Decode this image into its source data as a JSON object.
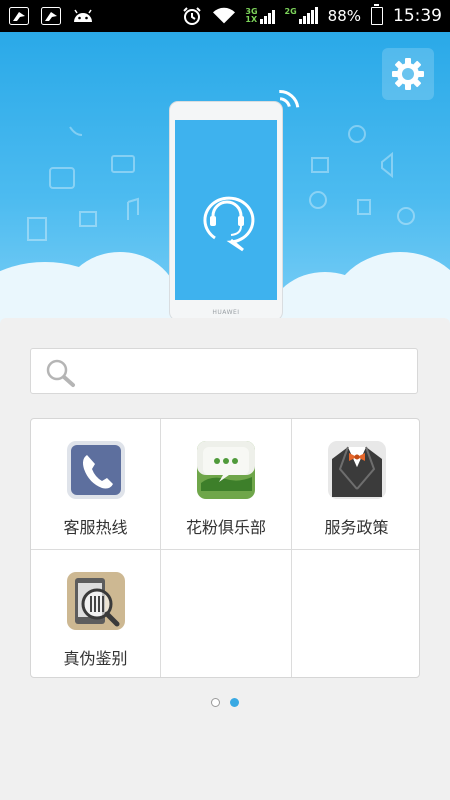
{
  "status_bar": {
    "battery": "88%",
    "time": "15:39",
    "network_tags": [
      "3G",
      "1X",
      "2G"
    ],
    "notification_icons": [
      "bird-app-icon",
      "bird-app-icon",
      "android-icon"
    ],
    "status_icons": [
      "alarm-icon",
      "wifi-icon",
      "signal-icon",
      "battery-charging-icon"
    ]
  },
  "hero": {
    "phone_brand": "HUAWEI",
    "screen_icon": "headset-chat-icon",
    "settings_icon": "gear-icon",
    "colors": {
      "sky_top": "#2aa9e8",
      "sky_bottom": "#7fd0f6",
      "screen": "#3eb2ee"
    }
  },
  "search": {
    "value": "",
    "placeholder": "",
    "icon": "search-icon"
  },
  "services": [
    {
      "label": "客服热线",
      "icon": "phone-handset-icon"
    },
    {
      "label": "花粉俱乐部",
      "icon": "chat-bubble-icon"
    },
    {
      "label": "服务政策",
      "icon": "suit-bowtie-icon"
    },
    {
      "label": "真伪鉴别",
      "icon": "barcode-magnifier-icon"
    }
  ],
  "pager": {
    "pages": 2,
    "current": 2
  }
}
